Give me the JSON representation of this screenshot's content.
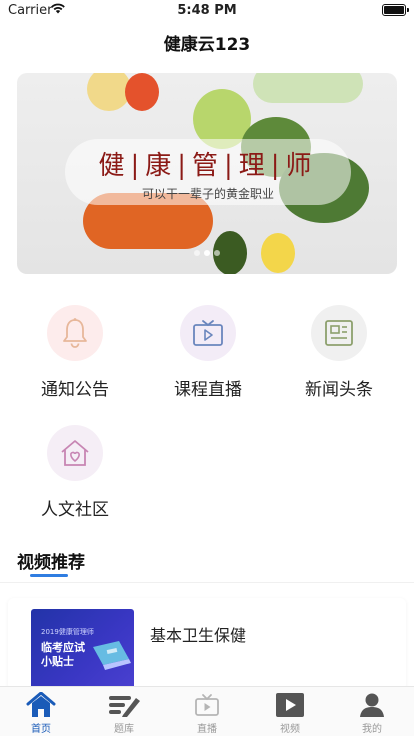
{
  "status": {
    "carrier": "Carrier",
    "time": "5:48 PM"
  },
  "nav": {
    "title": "健康云123"
  },
  "banner": {
    "title": "健|康|管|理|师",
    "subtitle": "可以干一辈子的黄金职业"
  },
  "menu": [
    {
      "label": "通知公告",
      "icon": "bell-icon"
    },
    {
      "label": "课程直播",
      "icon": "live-tv-icon"
    },
    {
      "label": "新闻头条",
      "icon": "newspaper-icon"
    },
    {
      "label": "人文社区",
      "icon": "home-heart-icon"
    }
  ],
  "section": {
    "title": "视频推荐"
  },
  "videos": [
    {
      "title": "基本卫生保健",
      "thumb_top": "2019健康管理师",
      "thumb_main": "临考应试小贴士"
    }
  ],
  "tabs": [
    {
      "label": "首页",
      "icon": "home-icon",
      "active": true
    },
    {
      "label": "题库",
      "icon": "question-bank-icon",
      "active": false
    },
    {
      "label": "直播",
      "icon": "live-tv-icon",
      "active": false
    },
    {
      "label": "视频",
      "icon": "play-icon",
      "active": false
    },
    {
      "label": "我的",
      "icon": "user-icon",
      "active": false
    }
  ],
  "colors": {
    "accent": "#2f7de1",
    "tab_active": "#1a5bb8",
    "banner_title": "#8b1a16"
  }
}
